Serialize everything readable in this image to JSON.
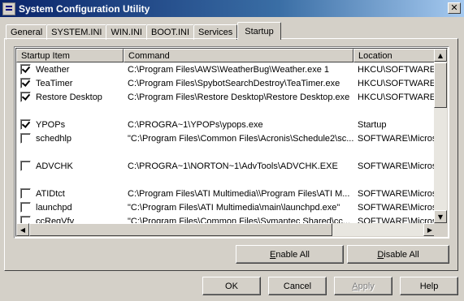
{
  "window": {
    "title": "System Configuration Utility",
    "close_glyph": "✕"
  },
  "tabs": [
    "General",
    "SYSTEM.INI",
    "WIN.INI",
    "BOOT.INI",
    "Services",
    "Startup"
  ],
  "active_tab": "Startup",
  "list": {
    "columns": [
      "Startup Item",
      "Command",
      "Location"
    ],
    "rows": [
      {
        "checked": true,
        "item": "Weather",
        "command": "C:\\Program Files\\AWS\\WeatherBug\\Weather.exe 1",
        "location": "HKCU\\SOFTWARE\\M"
      },
      {
        "checked": true,
        "item": "TeaTimer",
        "command": "C:\\Program Files\\SpybotSearchDestroy\\TeaTimer.exe",
        "location": "HKCU\\SOFTWARE\\M"
      },
      {
        "checked": true,
        "item": "Restore Desktop",
        "command": "C:\\Program Files\\Restore Desktop\\Restore Desktop.exe",
        "location": "HKCU\\SOFTWARE\\M"
      },
      {
        "blank": true
      },
      {
        "checked": true,
        "item": "YPOPs",
        "command": "C:\\PROGRA~1\\YPOPs\\ypops.exe",
        "location": "Startup"
      },
      {
        "checked": false,
        "item": "schedhlp",
        "command": "\"C:\\Program Files\\Common Files\\Acronis\\Schedule2\\sc...",
        "location": "SOFTWARE\\Microso"
      },
      {
        "blank": true
      },
      {
        "checked": false,
        "item": "ADVCHK",
        "command": "C:\\PROGRA~1\\NORTON~1\\AdvTools\\ADVCHK.EXE",
        "location": "SOFTWARE\\Microso"
      },
      {
        "blank": true
      },
      {
        "checked": false,
        "item": "ATIDtct",
        "command": "C:\\Program Files\\ATI Multimedia\\\\Program Files\\ATI M...",
        "location": "SOFTWARE\\Microso"
      },
      {
        "checked": false,
        "item": "launchpd",
        "command": "\"C:\\Program Files\\ATI Multimedia\\main\\launchpd.exe\"",
        "location": "SOFTWARE\\Microso"
      },
      {
        "checked": false,
        "item": "ccRegVfy",
        "command": "\"C:\\Program Files\\Common Files\\Symantec Shared\\cc...",
        "location": "SOFTWARE\\Microso"
      }
    ]
  },
  "scroll_glyphs": {
    "up": "▲",
    "down": "▼",
    "left": "◀",
    "right": "▶"
  },
  "buttons": {
    "enable_all": {
      "pre": "",
      "key": "E",
      "post": "nable All"
    },
    "disable_all": {
      "pre": "",
      "key": "D",
      "post": "isable All"
    },
    "ok": "OK",
    "cancel": "Cancel",
    "apply": {
      "pre": "",
      "key": "A",
      "post": "pply"
    },
    "help": "Help"
  }
}
